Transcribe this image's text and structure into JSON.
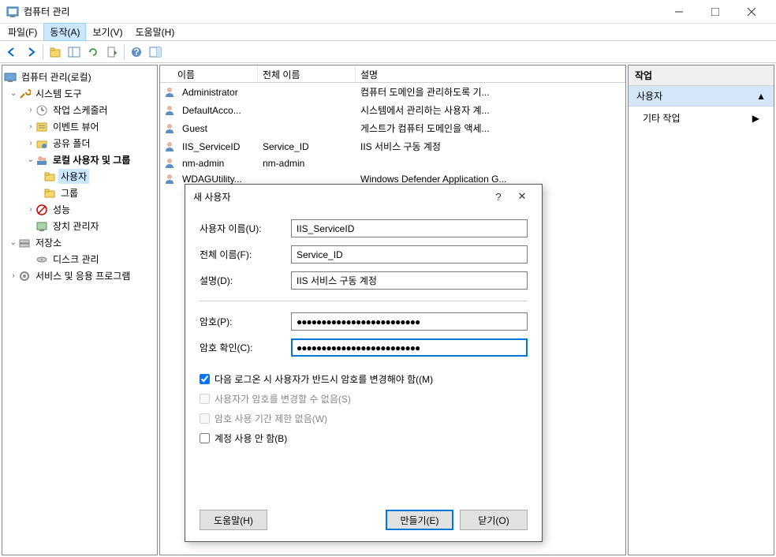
{
  "window": {
    "title": "컴퓨터 관리"
  },
  "menu": {
    "file": "파일(F)",
    "action": "동작(A)",
    "view": "보기(V)",
    "help": "도움말(H)"
  },
  "tree": {
    "root": "컴퓨터 관리(로컬)",
    "system_tools": "시스템 도구",
    "task_scheduler": "작업 스케줄러",
    "event_viewer": "이벤트 뷰어",
    "shared_folders": "공유 폴더",
    "local_users": "로컬 사용자 및 그룹",
    "users": "사용자",
    "groups": "그룹",
    "performance": "성능",
    "device_manager": "장치 관리자",
    "storage": "저장소",
    "disk_management": "디스크 관리",
    "services": "서비스 및 응용 프로그램"
  },
  "list": {
    "headers": {
      "name": "이름",
      "fullname": "전체 이름",
      "desc": "설명"
    },
    "rows": [
      {
        "name": "Administrator",
        "fullname": "",
        "desc": "컴퓨터 도메인을 관리하도록 기..."
      },
      {
        "name": "DefaultAcco...",
        "fullname": "",
        "desc": "시스템에서 관리하는 사용자 계..."
      },
      {
        "name": "Guest",
        "fullname": "",
        "desc": "게스트가 컴퓨터 도메인을 액세..."
      },
      {
        "name": "IIS_ServiceID",
        "fullname": "Service_ID",
        "desc": "IIS 서비스 구동 계정"
      },
      {
        "name": "nm-admin",
        "fullname": "nm-admin",
        "desc": ""
      },
      {
        "name": "WDAGUtility...",
        "fullname": "",
        "desc": "Windows Defender Application G..."
      }
    ]
  },
  "actions": {
    "header": "작업",
    "section": "사용자",
    "item1": "기타 작업"
  },
  "dialog": {
    "title": "새 사용자",
    "username_label": "사용자 이름(U):",
    "username_value": "IIS_ServiceID",
    "fullname_label": "전체 이름(F):",
    "fullname_value": "Service_ID",
    "desc_label": "설명(D):",
    "desc_value": "IIS 서비스 구동 계정",
    "password_label": "암호(P):",
    "password_value": "●●●●●●●●●●●●●●●●●●●●●●●●●",
    "confirm_label": "암호 확인(C):",
    "confirm_value": "●●●●●●●●●●●●●●●●●●●●●●●●●",
    "check1": "다음 로그온 시 사용자가 반드시 암호를 변경해야 함((M)",
    "check2": "사용자가 암호를 변경할 수 없음(S)",
    "check3": "암호 사용 기간 제한 없음(W)",
    "check4": "계정 사용 안 함(B)",
    "btn_help": "도움말(H)",
    "btn_create": "만들기(E)",
    "btn_close": "닫기(O)"
  }
}
